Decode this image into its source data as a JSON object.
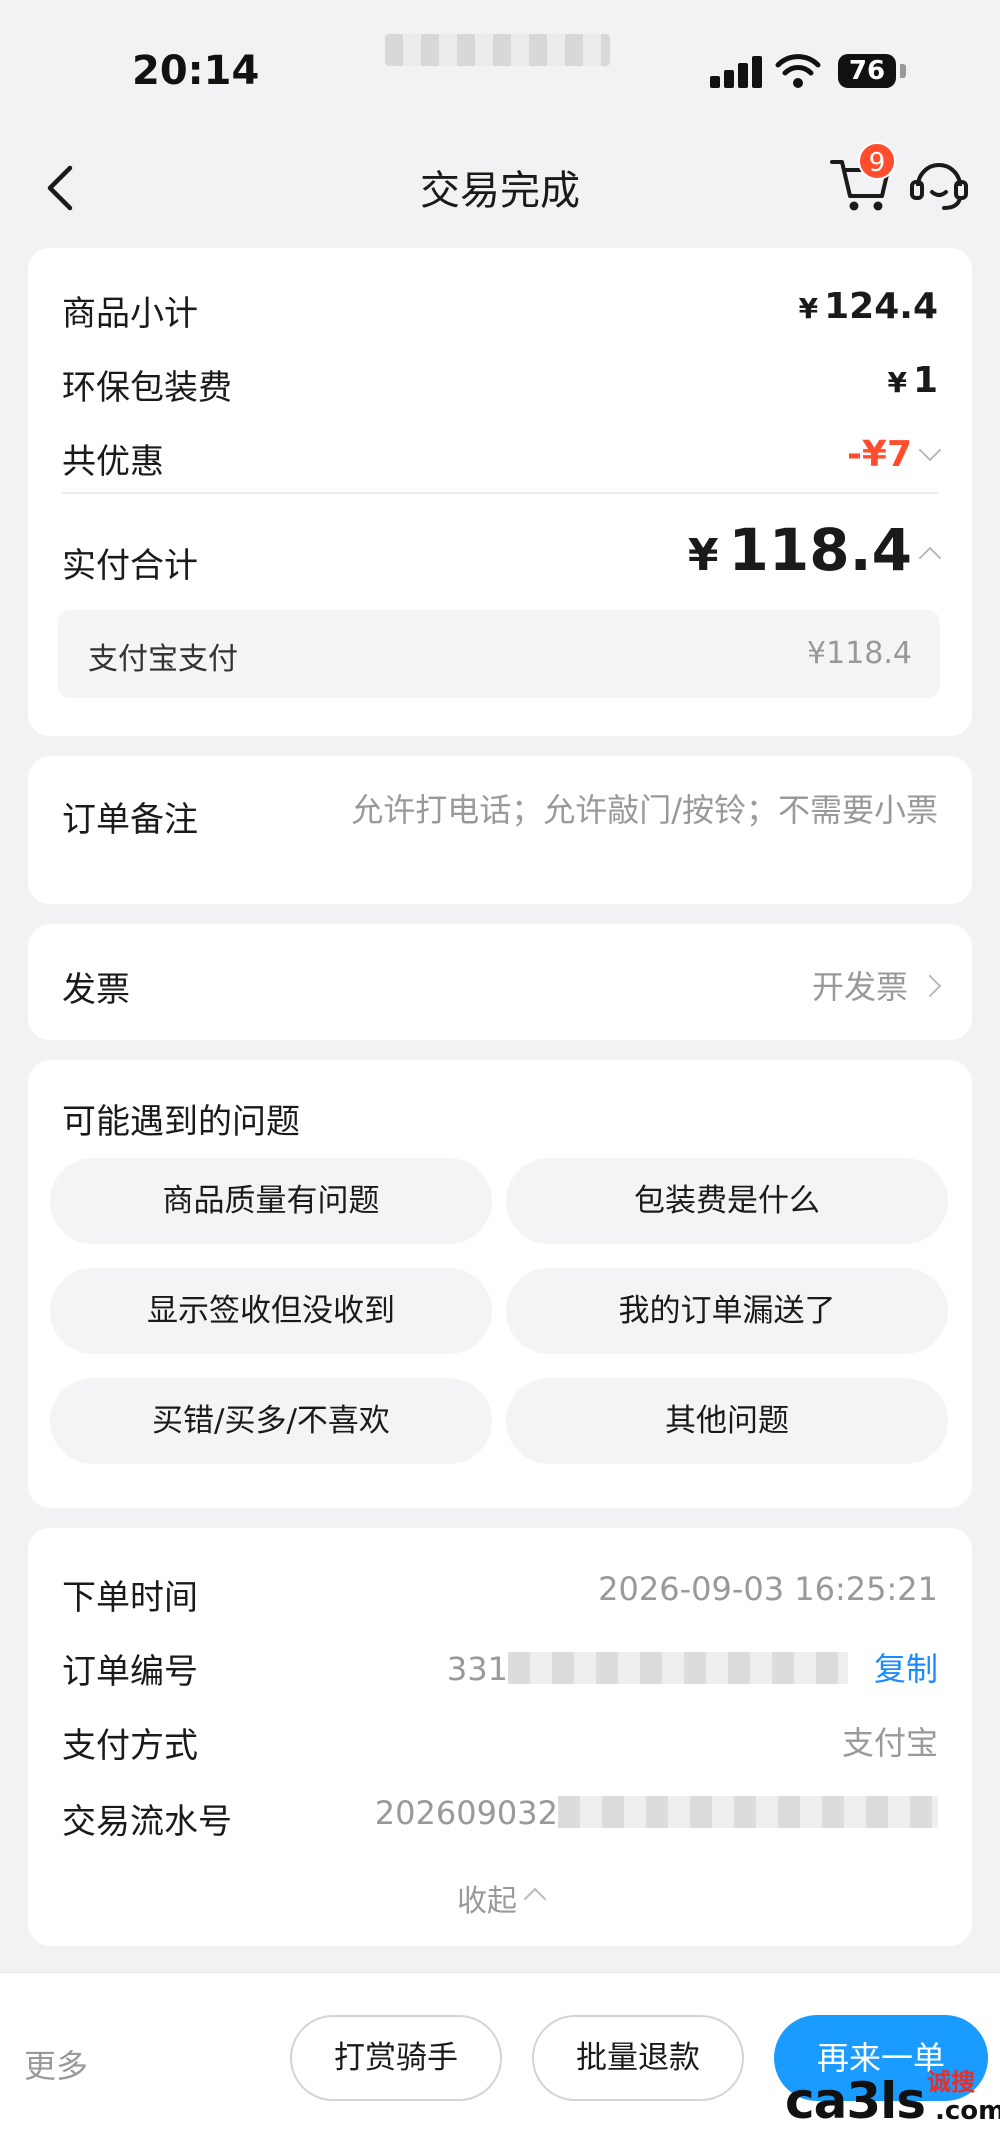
{
  "status_bar": {
    "time": "20:14",
    "battery": "76"
  },
  "header": {
    "title": "交易完成",
    "cart_badge": "9"
  },
  "price": {
    "subtotal_label": "商品小计",
    "subtotal_value": "124.4",
    "packaging_label": "环保包装费",
    "packaging_value": "1",
    "discount_label": "共优惠",
    "discount_value": "-¥7",
    "total_label": "实付合计",
    "total_value": "118.4",
    "currency": "¥",
    "method_label": "支付宝支付",
    "method_value": "¥118.4"
  },
  "note": {
    "label": "订单备注",
    "text": "允许打电话；允许敲门/按铃；不需要小票"
  },
  "invoice": {
    "label": "发票",
    "action": "开发票"
  },
  "faq": {
    "title": "可能遇到的问题",
    "items": [
      "商品质量有问题",
      "包装费是什么",
      "显示签收但没收到",
      "我的订单漏送了",
      "买错/买多/不喜欢",
      "其他问题"
    ]
  },
  "order_info": {
    "time_label": "下单时间",
    "time_value": "2026-09-03 16:25:21",
    "number_label": "订单编号",
    "number_prefix": "331",
    "copy_label": "复制",
    "payment_label": "支付方式",
    "payment_value": "支付宝",
    "serial_label": "交易流水号",
    "serial_prefix": "202609032",
    "collapse_label": "收起"
  },
  "bottom": {
    "more": "更多",
    "tip_rider": "打赏骑手",
    "batch_refund": "批量退款",
    "reorder": "再来一单"
  },
  "watermark": {
    "site": "ca3ls",
    "brand": "诚搜",
    "tld": ".com"
  },
  "colors": {
    "accent": "#1a9bff",
    "discount": "#ff4d2d",
    "copy_link": "#1a8cff"
  }
}
